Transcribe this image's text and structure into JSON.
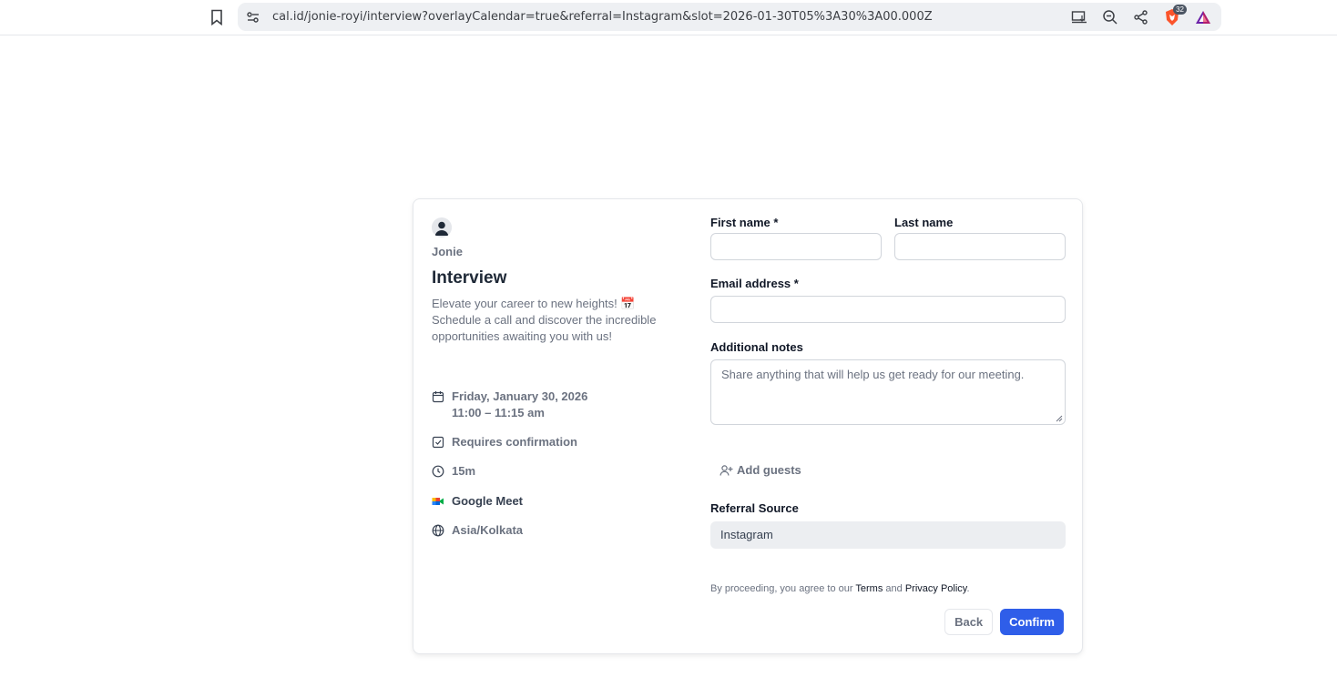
{
  "browser": {
    "url": "cal.id/jonie-royi/interview?overlayCalendar=true&referral=Instagram&slot=2026-01-30T05%3A30%3A00.000Z",
    "shields_badge": "32"
  },
  "event": {
    "host": "Jonie",
    "title": "Interview",
    "description": "Elevate your career to new heights! 📅 Schedule a call and discover the incredible opportunities awaiting you with us!",
    "date": "Friday, January 30, 2026",
    "time": "11:00 – 11:15 am",
    "confirmation": "Requires confirmation",
    "duration": "15m",
    "location": "Google Meet",
    "timezone": "Asia/Kolkata"
  },
  "form": {
    "first_name_label": "First name",
    "last_name_label": "Last name",
    "email_label": "Email address",
    "required_mark": "*",
    "notes_label": "Additional notes",
    "notes_placeholder": "Share anything that will help us get ready for our meeting.",
    "add_guests": "Add guests",
    "referral_label": "Referral Source",
    "referral_value": "Instagram",
    "terms_prefix": "By proceeding, you agree to our",
    "terms_link": "Terms",
    "terms_and": "and",
    "privacy_link": "Privacy Policy",
    "terms_suffix": ".",
    "back_button": "Back",
    "confirm_button": "Confirm"
  },
  "colors": {
    "accent": "#2f5ee9",
    "brave": "#fb542b"
  }
}
